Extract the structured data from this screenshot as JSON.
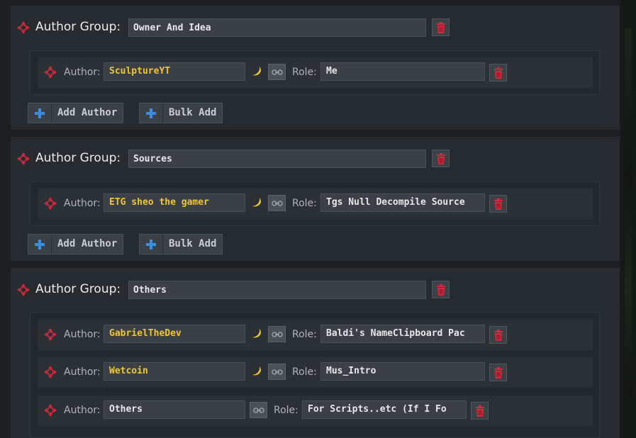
{
  "labels": {
    "author_group": "Author Group:",
    "author": "Author:",
    "role": "Role:",
    "add_author": "Add Author",
    "bulk_add": "Bulk Add"
  },
  "icons": {
    "move": "move-arrows-icon",
    "trash": "trash-icon",
    "banana": "banana-icon",
    "link": "link-icon",
    "plus": "plus-icon"
  },
  "colors": {
    "accent_red": "#d8263a",
    "author_name_yellow": "#f0c530",
    "plus_blue": "#3a8fe0"
  },
  "groups": [
    {
      "name": "Owner And Idea",
      "authors": [
        {
          "author": "SculptureYT",
          "role": "Me"
        }
      ]
    },
    {
      "name": "Sources",
      "authors": [
        {
          "author": "ETG sheo the gamer",
          "role": "Tgs Null Decompile Source"
        }
      ]
    },
    {
      "name": "Others",
      "authors": [
        {
          "author": "GabrielTheDev",
          "role": "Baldi's NameClipboard Pac"
        },
        {
          "author": "Wetcoin",
          "role": "Mus_Intro"
        },
        {
          "author": "Others",
          "role": "For Scripts..etc (If I Fo"
        }
      ]
    }
  ]
}
